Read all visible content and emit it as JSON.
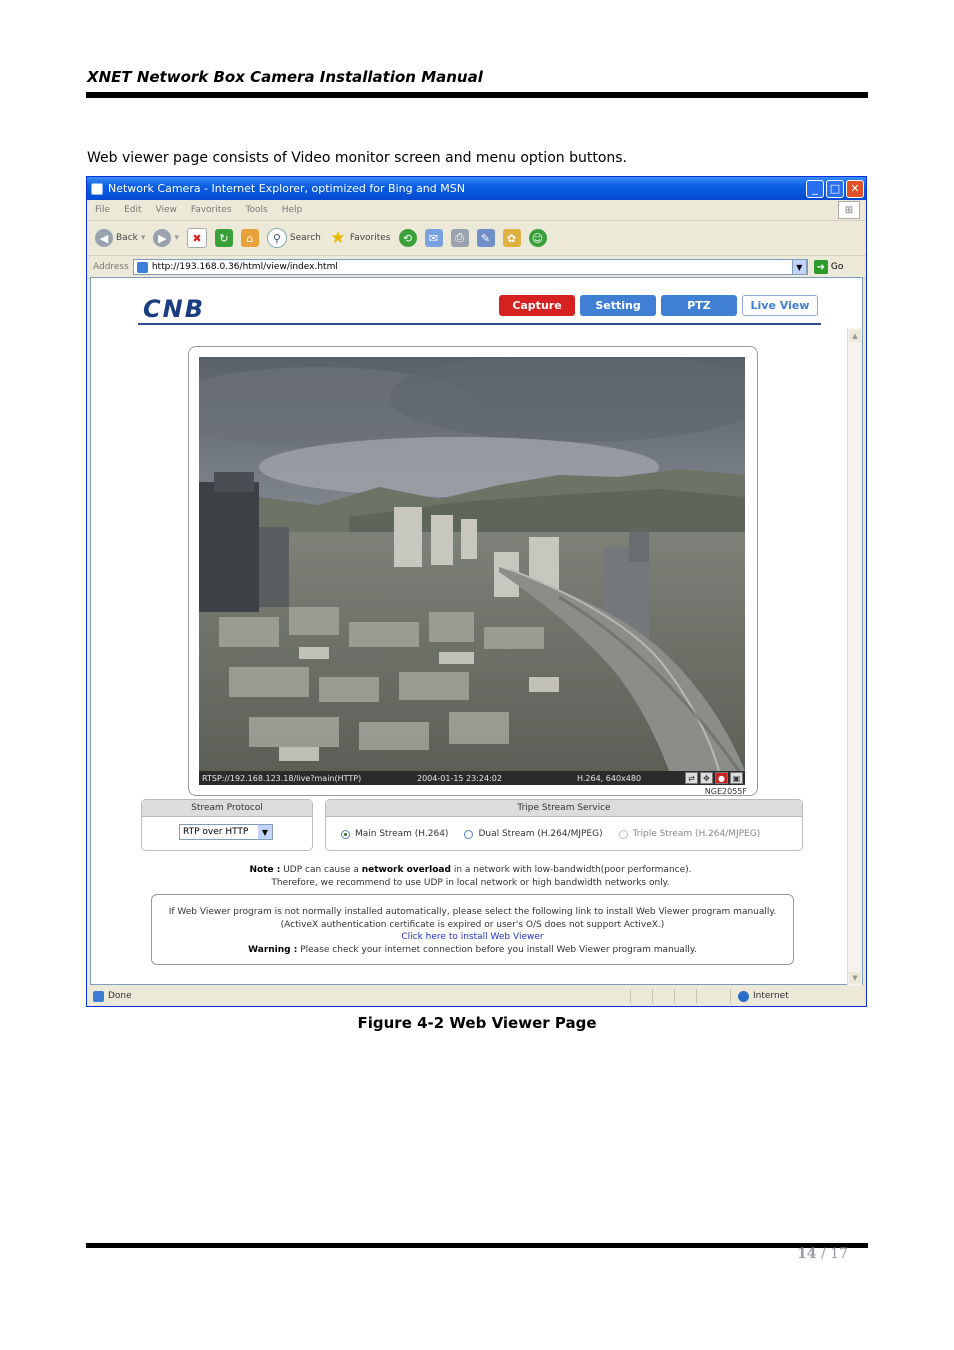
{
  "document": {
    "header_title": "XNET Network Box Camera Installation Manual",
    "intro_text": "Web viewer page consists of Video monitor screen and menu option buttons.",
    "figure_caption": "Figure 4-2 Web Viewer Page",
    "page_current": "14",
    "page_sep": " / ",
    "page_total": "17"
  },
  "browser": {
    "window_title": "Network Camera - Internet Explorer, optimized for Bing and MSN",
    "menu": [
      "File",
      "Edit",
      "View",
      "Favorites",
      "Tools",
      "Help"
    ],
    "toolbar": {
      "back": "Back",
      "search": "Search",
      "favorites": "Favorites"
    },
    "address_label": "Address",
    "address_url": "http://193.168.0.36/html/view/index.html",
    "go_label": "Go",
    "status_left": "Done",
    "status_zone": "Internet"
  },
  "page": {
    "logo_text": "CNB",
    "nav": {
      "capture": "Capture",
      "setting": "Setting",
      "ptz": "PTZ",
      "live_view": "Live View"
    },
    "video": {
      "rtsp": "RTSP://192.168.123.18/live?main(HTTP)",
      "datetime": "2004-01-15 23:24:02",
      "codec": "H.264, 640x480",
      "model": "NGE2055F"
    },
    "stream_protocol": {
      "title": "Stream Protocol",
      "selected": "RTP over HTTP"
    },
    "stream_service": {
      "title": "Tripe Stream Service",
      "options": [
        "Main Stream (H.264)",
        "Dual Stream (H.264/MJPEG)",
        "Triple Stream (H.264/MJPEG)"
      ],
      "selected_index": 0
    },
    "note": {
      "label": "Note :",
      "text1": "UDP can cause a",
      "bold": "network overload",
      "text2": "in a network with low-bandwidth(poor performance).",
      "line2": "Therefore, we recommend to use UDP in local network or high bandwidth networks only."
    },
    "install": {
      "line1": "If Web Viewer program is not normally installed automatically, please select the following link to install Web Viewer program manually.",
      "line2": "(ActiveX authentication certificate is expired or user's O/S does not support ActiveX.)",
      "link": "Click here to install Web Viewer",
      "warning_label": "Warning :",
      "warning_text": "Please check your internet connection before you install Web Viewer program manually."
    }
  }
}
